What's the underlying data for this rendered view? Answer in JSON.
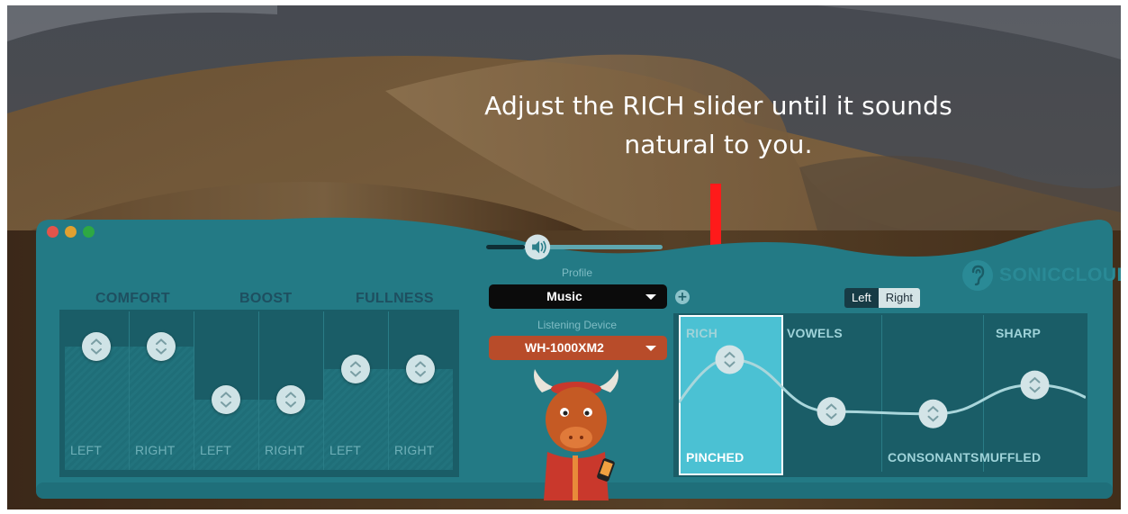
{
  "instruction": "Adjust the RICH slider until it sounds natural to you.",
  "colors": {
    "panel": "#237a85",
    "panel_dark": "#1a5d67",
    "accent_active": "#4bc1d3",
    "device_select": "#b84c2a",
    "arrow": "#ff1a1a"
  },
  "volume": {
    "level": 0.22
  },
  "profile": {
    "label": "Profile",
    "value": "Music"
  },
  "device": {
    "label": "Listening Device",
    "value": "WH-1000XM2"
  },
  "brand": {
    "name": "SONICCLOUD"
  },
  "ear_toggle": {
    "left": "Left",
    "right": "Right",
    "selected": "Left"
  },
  "boost_groups": [
    {
      "title": "COMFORT",
      "left_label": "LEFT",
      "right_label": "RIGHT",
      "left_level": 0.88,
      "right_level": 0.88
    },
    {
      "title": "BOOST",
      "left_label": "LEFT",
      "right_label": "RIGHT",
      "left_level": 0.5,
      "right_level": 0.5
    },
    {
      "title": "FULLNESS",
      "left_label": "LEFT",
      "right_label": "RIGHT",
      "left_level": 0.72,
      "right_level": 0.72
    }
  ],
  "eq": {
    "columns": [
      {
        "top": "RICH",
        "bottom": "PINCHED",
        "level": 0.78,
        "active": true
      },
      {
        "top": "VOWELS",
        "bottom": "",
        "level": 0.35,
        "active": false
      },
      {
        "top": "",
        "bottom": "CONSONANTS",
        "level": 0.33,
        "active": false
      },
      {
        "top": "SHARP",
        "bottom": "MUFFLED",
        "level": 0.57,
        "active": false
      }
    ]
  }
}
